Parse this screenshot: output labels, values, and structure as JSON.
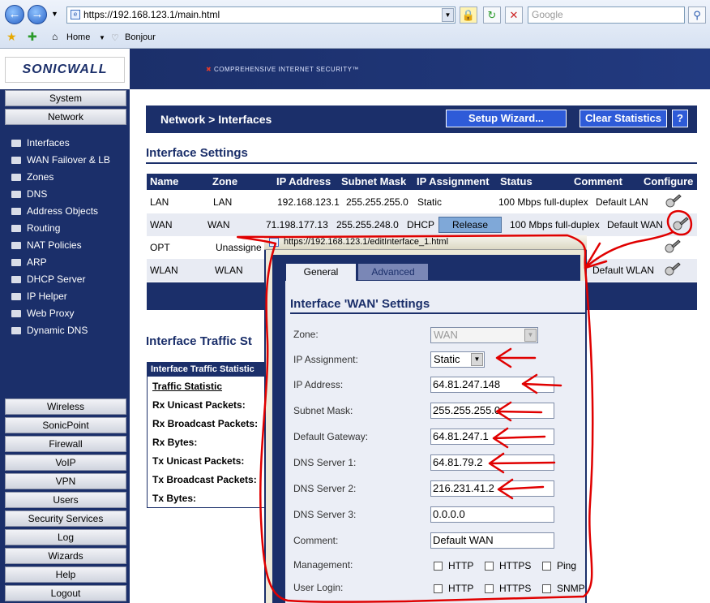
{
  "browser": {
    "url": "https://192.168.123.1/main.html",
    "search_placeholder": "Google",
    "bookmarks": {
      "home": "Home",
      "bonjour": "Bonjour"
    }
  },
  "header": {
    "logo": "SONICWALL",
    "tagline": "COMPREHENSIVE INTERNET SECURITY™"
  },
  "sidebar": {
    "top_buttons": [
      "System",
      "Network"
    ],
    "network_items": [
      "Interfaces",
      "WAN Failover & LB",
      "Zones",
      "DNS",
      "Address Objects",
      "Routing",
      "NAT Policies",
      "ARP",
      "DHCP Server",
      "IP Helper",
      "Web Proxy",
      "Dynamic DNS"
    ],
    "bottom_buttons": [
      "Wireless",
      "SonicPoint",
      "Firewall",
      "VoIP",
      "VPN",
      "Users",
      "Security Services",
      "Log",
      "Wizards",
      "Help",
      "Logout"
    ]
  },
  "page": {
    "title": "Network > Interfaces",
    "setup_wizard": "Setup Wizard...",
    "clear_statistics": "Clear Statistics",
    "help": "?",
    "section_interfaces": "Interface Settings",
    "section_traffic": "Interface Traffic St"
  },
  "interfaces": {
    "headers": {
      "name": "Name",
      "zone": "Zone",
      "ip": "IP Address",
      "mask": "Subnet Mask",
      "assign": "IP Assignment",
      "status": "Status",
      "comment": "Comment",
      "configure": "Configure"
    },
    "rows": [
      {
        "name": "LAN",
        "zone": "LAN",
        "ip": "192.168.123.1",
        "mask": "255.255.255.0",
        "assign": "Static",
        "status": "100 Mbps full-duplex",
        "comment": "Default LAN"
      },
      {
        "name": "WAN",
        "zone": "WAN",
        "ip": "71.198.177.13",
        "mask": "255.255.248.0",
        "assign": "DHCP",
        "release": "Release",
        "status": "100 Mbps full-duplex",
        "comment": "Default WAN"
      },
      {
        "name": "OPT",
        "zone": "Unassigne"
      },
      {
        "name": "WLAN",
        "zone": "WLAN",
        "comment": "Default WLAN"
      }
    ]
  },
  "traffic": {
    "header": "Interface Traffic Statistic",
    "rows": [
      "Traffic Statistic",
      "Rx Unicast Packets:",
      "Rx Broadcast Packets:",
      "Rx Bytes:",
      "Tx Unicast Packets:",
      "Tx Broadcast Packets:",
      "Tx Bytes:"
    ]
  },
  "popup": {
    "url": "https://192.168.123.1/editInterface_1.html",
    "tabs": {
      "general": "General",
      "advanced": "Advanced"
    },
    "title": "Interface 'WAN' Settings",
    "labels": {
      "zone": "Zone:",
      "ip_assignment": "IP Assignment:",
      "ip_address": "IP Address:",
      "subnet_mask": "Subnet Mask:",
      "gateway": "Default Gateway:",
      "dns1": "DNS Server 1:",
      "dns2": "DNS Server 2:",
      "dns3": "DNS Server 3:",
      "comment": "Comment:",
      "management": "Management:",
      "user_login": "User Login:"
    },
    "values": {
      "zone": "WAN",
      "ip_assignment": "Static",
      "ip_address": "64.81.247.148",
      "subnet_mask": "255.255.255.0",
      "gateway": "64.81.247.1",
      "dns1": "64.81.79.2",
      "dns2": "216.231.41.2",
      "dns3": "0.0.0.0",
      "comment": "Default WAN"
    },
    "checkboxes": {
      "http": "HTTP",
      "https": "HTTPS",
      "ping": "Ping",
      "snmp": "SNMP"
    }
  },
  "colors": {
    "navy": "#1b2f6a",
    "button_blue": "#2e5bd8",
    "annotation_red": "#e00000"
  }
}
